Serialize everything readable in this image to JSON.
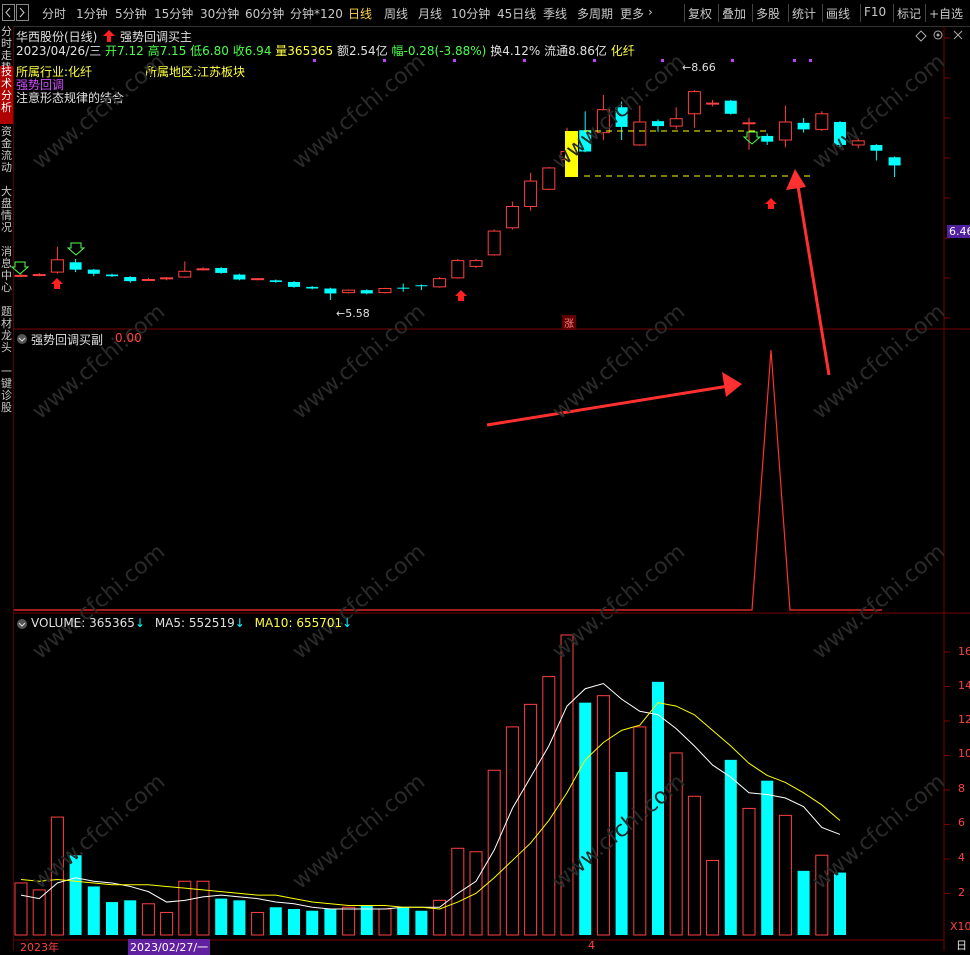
{
  "toolbar": {
    "timeframes": [
      "分时",
      "1分钟",
      "5分钟",
      "15分钟",
      "30分钟",
      "60分钟",
      "分钟*120",
      "日线",
      "周线",
      "月线",
      "10分钟",
      "45日线",
      "季线",
      "多周期",
      "更多"
    ],
    "active": "日线",
    "more_arrow": "›",
    "right_buttons": [
      "复权",
      "叠加",
      "多股",
      "统计",
      "画线",
      "F10",
      "标记",
      "+自选"
    ]
  },
  "sidebar": {
    "tabs": [
      "分时走势",
      "技术分析",
      "资金流动",
      "大盘情况",
      "消息中心",
      "题材龙头",
      "一键诊股"
    ],
    "active": "技术分析"
  },
  "header": {
    "stock_name": "华西股份(日线)",
    "formula": "强势回调买主",
    "date": "2023/04/26/三",
    "open": "开7.12",
    "high": "高7.15",
    "low": "低6.80",
    "close": "收6.94",
    "volume": "量365365",
    "amount": "额2.54亿",
    "change": "幅-0.28(-3.88%)",
    "turnover": "换4.12%",
    "float": "流通8.86亿",
    "sector": "化纤",
    "industry_label": "所属行业:",
    "industry_value": "化纤",
    "region_label": "所属地区:",
    "region_value": "江苏板块",
    "signal_text": "强势回调",
    "note": "注意形态规律的结合"
  },
  "main_chart": {
    "high_marker": "8.66",
    "low_marker": "5.58",
    "price_tag": "6.46",
    "zhang": "涨"
  },
  "indicator": {
    "title": "强势回调买副",
    "value": "0.00"
  },
  "volume": {
    "title": "VOLUME:",
    "value": "365365",
    "ma5_label": "MA5:",
    "ma5_value": "552519",
    "ma10_label": "MA10:",
    "ma10_value": "655701",
    "arrow": "↓",
    "axis_ticks": [
      "16",
      "14",
      "12",
      "10",
      "8",
      "6",
      "4",
      "2"
    ],
    "axis_unit": "X10",
    "bottom_dates": [
      "2023年",
      "2023/02/27/一",
      "4"
    ],
    "right_corner": "日"
  },
  "colors": {
    "up": "#ff4040",
    "down": "#00ffff",
    "ma5": "#ffffff",
    "ma10": "#ffff00",
    "accent": "#ffd24a",
    "purple": "#c040ff"
  },
  "watermark": "www.cfchi.com",
  "chart_data": {
    "type": "candlestick",
    "candles": [
      {
        "o": 6.39,
        "c": 6.4,
        "h": 6.42,
        "l": 6.38
      },
      {
        "o": 6.4,
        "c": 6.41,
        "h": 6.43,
        "l": 6.39
      },
      {
        "o": 6.44,
        "c": 6.59,
        "h": 6.75,
        "l": 6.42
      },
      {
        "o": 6.56,
        "c": 6.47,
        "h": 6.6,
        "l": 6.44
      },
      {
        "o": 6.47,
        "c": 6.42,
        "h": 6.48,
        "l": 6.39
      },
      {
        "o": 6.41,
        "c": 6.39,
        "h": 6.42,
        "l": 6.38
      },
      {
        "o": 6.38,
        "c": 6.33,
        "h": 6.39,
        "l": 6.31
      },
      {
        "o": 6.34,
        "c": 6.35,
        "h": 6.37,
        "l": 6.33
      },
      {
        "o": 6.36,
        "c": 6.37,
        "h": 6.38,
        "l": 6.34
      },
      {
        "o": 6.38,
        "c": 6.45,
        "h": 6.57,
        "l": 6.37
      },
      {
        "o": 6.47,
        "c": 6.48,
        "h": 6.5,
        "l": 6.46
      },
      {
        "o": 6.49,
        "c": 6.43,
        "h": 6.5,
        "l": 6.42
      },
      {
        "o": 6.41,
        "c": 6.35,
        "h": 6.42,
        "l": 6.34
      },
      {
        "o": 6.35,
        "c": 6.36,
        "h": 6.37,
        "l": 6.34
      },
      {
        "o": 6.34,
        "c": 6.32,
        "h": 6.35,
        "l": 6.31
      },
      {
        "o": 6.32,
        "c": 6.26,
        "h": 6.33,
        "l": 6.25
      },
      {
        "o": 6.26,
        "c": 6.24,
        "h": 6.27,
        "l": 6.23
      },
      {
        "o": 6.24,
        "c": 6.18,
        "h": 6.25,
        "l": 6.1
      },
      {
        "o": 6.19,
        "c": 6.22,
        "h": 6.23,
        "l": 6.18
      },
      {
        "o": 6.22,
        "c": 6.18,
        "h": 6.23,
        "l": 6.17
      },
      {
        "o": 6.19,
        "c": 6.24,
        "h": 6.25,
        "l": 6.18
      },
      {
        "o": 6.25,
        "c": 6.24,
        "h": 6.3,
        "l": 6.2
      },
      {
        "o": 6.28,
        "c": 6.27,
        "h": 6.29,
        "l": 6.22
      },
      {
        "o": 6.26,
        "c": 6.36,
        "h": 6.38,
        "l": 6.25
      },
      {
        "o": 6.37,
        "c": 6.58,
        "h": 6.6,
        "l": 6.36
      },
      {
        "o": 6.51,
        "c": 6.58,
        "h": 6.6,
        "l": 6.49
      },
      {
        "o": 6.65,
        "c": 6.94,
        "h": 6.96,
        "l": 6.64
      },
      {
        "o": 6.98,
        "c": 7.24,
        "h": 7.3,
        "l": 6.96
      },
      {
        "o": 7.24,
        "c": 7.55,
        "h": 7.65,
        "l": 7.19
      },
      {
        "o": 7.45,
        "c": 7.71,
        "h": 7.72,
        "l": 7.44
      },
      {
        "o": 7.81,
        "c": 7.91,
        "h": 8.2,
        "l": 7.65
      },
      {
        "o": 8.17,
        "c": 7.91,
        "h": 8.4,
        "l": 7.9
      },
      {
        "o": 8.14,
        "c": 8.42,
        "h": 8.6,
        "l": 8.05
      },
      {
        "o": 8.45,
        "c": 8.21,
        "h": 8.52,
        "l": 8.05
      },
      {
        "o": 7.99,
        "c": 8.27,
        "h": 8.47,
        "l": 7.98
      },
      {
        "o": 8.28,
        "c": 8.22,
        "h": 8.3,
        "l": 8.15
      },
      {
        "o": 8.22,
        "c": 8.31,
        "h": 8.45,
        "l": 8.18
      },
      {
        "o": 8.37,
        "c": 8.64,
        "h": 8.66,
        "l": 8.2
      },
      {
        "o": 8.49,
        "c": 8.5,
        "h": 8.54,
        "l": 8.46
      },
      {
        "o": 8.53,
        "c": 8.37,
        "h": 8.54,
        "l": 8.36
      },
      {
        "o": 8.26,
        "c": 8.26,
        "h": 8.32,
        "l": 7.93
      },
      {
        "o": 8.1,
        "c": 8.03,
        "h": 8.13,
        "l": 7.99
      },
      {
        "o": 8.05,
        "c": 8.27,
        "h": 8.47,
        "l": 7.96
      },
      {
        "o": 8.26,
        "c": 8.18,
        "h": 8.32,
        "l": 8.14
      },
      {
        "o": 8.18,
        "c": 8.37,
        "h": 8.4,
        "l": 8.16
      },
      {
        "o": 8.27,
        "c": 7.99,
        "h": 8.28,
        "l": 7.95
      },
      {
        "o": 7.99,
        "c": 8.04,
        "h": 8.07,
        "l": 7.95
      },
      {
        "o": 7.99,
        "c": 7.92,
        "h": 8.0,
        "l": 7.8
      },
      {
        "o": 7.84,
        "c": 7.74,
        "h": 7.85,
        "l": 7.6
      }
    ],
    "volume": [
      3.0,
      2.6,
      6.8,
      4.6,
      2.8,
      1.9,
      2.0,
      1.8,
      1.3,
      3.1,
      3.1,
      2.1,
      2.0,
      1.3,
      1.6,
      1.5,
      1.4,
      1.5,
      1.6,
      1.7,
      1.5,
      1.6,
      1.4,
      2.0,
      5.0,
      4.8,
      9.5,
      12.0,
      13.3,
      14.9,
      17.3,
      13.4,
      13.8,
      9.4,
      12.0,
      14.6,
      10.5,
      8.0,
      4.3,
      10.1,
      7.3,
      8.9,
      6.9,
      3.7,
      4.6,
      3.6
    ],
    "ma5": [
      2.3,
      2.1,
      3.0,
      3.3,
      3.1,
      3.0,
      2.8,
      2.5,
      1.9,
      2.0,
      2.2,
      2.3,
      2.2,
      2.1,
      1.9,
      1.8,
      1.6,
      1.5,
      1.5,
      1.5,
      1.5,
      1.6,
      1.6,
      1.6,
      2.4,
      3.1,
      4.9,
      7.3,
      9.1,
      10.9,
      13.2,
      14.2,
      14.5,
      13.6,
      12.9,
      12.7,
      11.9,
      10.9,
      9.8,
      9.1,
      8.2,
      8.1,
      7.9,
      7.4,
      6.2,
      5.8
    ],
    "ma10": [
      3.2,
      3.1,
      3.2,
      3.1,
      3.0,
      2.9,
      2.9,
      2.9,
      2.8,
      2.7,
      2.6,
      2.5,
      2.4,
      2.3,
      2.3,
      2.1,
      1.9,
      1.8,
      1.7,
      1.7,
      1.7,
      1.6,
      1.6,
      1.5,
      1.9,
      2.4,
      3.3,
      4.3,
      5.3,
      6.6,
      8.2,
      10.1,
      11.1,
      11.8,
      12.1,
      13.4,
      13.2,
      12.7,
      11.8,
      10.9,
      9.9,
      9.2,
      8.8,
      8.2,
      7.5,
      6.6
    ],
    "indicator": {
      "values_nonzero_index": 42,
      "peak": 1.0
    }
  }
}
